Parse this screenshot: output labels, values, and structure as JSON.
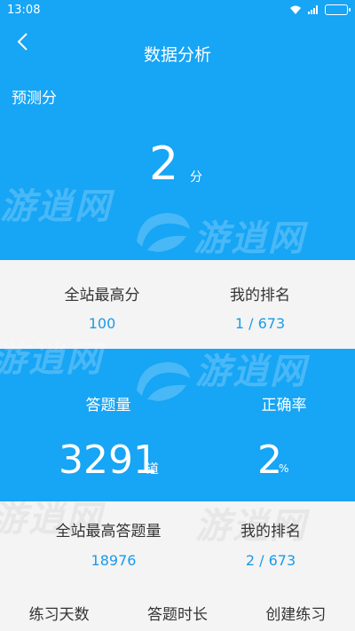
{
  "status": {
    "time": "13:08"
  },
  "header": {
    "title": "数据分析"
  },
  "prediction": {
    "label": "预测分",
    "score": "2",
    "unit": "分"
  },
  "stats_top": [
    {
      "label": "全站最高分",
      "value": "100"
    },
    {
      "label": "我的排名",
      "value": "1 / 673"
    }
  ],
  "stats_answer": [
    {
      "label": "答题量",
      "value": "3291",
      "unit": "道"
    },
    {
      "label": "正确率",
      "value": "2",
      "unit": "%"
    }
  ],
  "stats_bottom": [
    {
      "label": "全站最高答题量",
      "value": "18976"
    },
    {
      "label": "我的排名",
      "value": "2 / 673"
    }
  ],
  "tabs": [
    "练习天数",
    "答题时长",
    "创建练习"
  ],
  "watermark": "游逍网",
  "colors": {
    "primary": "#17a5f5",
    "value_text": "#1a9be8"
  }
}
